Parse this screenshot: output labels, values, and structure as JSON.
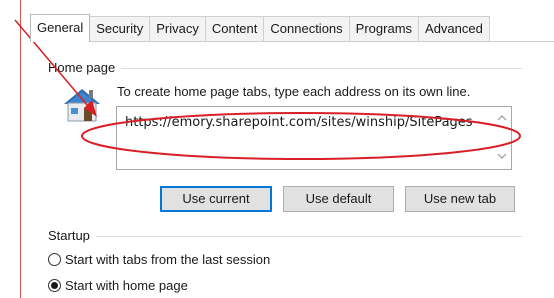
{
  "tabs": [
    {
      "label": "General",
      "active": true
    },
    {
      "label": "Security",
      "active": false
    },
    {
      "label": "Privacy",
      "active": false
    },
    {
      "label": "Content",
      "active": false
    },
    {
      "label": "Connections",
      "active": false
    },
    {
      "label": "Programs",
      "active": false
    },
    {
      "label": "Advanced",
      "active": false
    }
  ],
  "home_page": {
    "group_label": "Home page",
    "instruction": "To create home page tabs, type each address on its own line.",
    "url_value": "https://emory.sharepoint.com/sites/winship/SitePages",
    "icon": "house-icon"
  },
  "buttons": {
    "use_current": "Use current",
    "use_default": "Use default",
    "use_new_tab": "Use new tab"
  },
  "startup": {
    "group_label": "Startup",
    "options": [
      {
        "label": "Start with tabs from the last session",
        "selected": false
      },
      {
        "label": "Start with home page",
        "selected": true
      }
    ]
  },
  "colors": {
    "annotation_red": "#d91f26",
    "focus_blue": "#0078d7",
    "margin_line": "#d9534f"
  }
}
